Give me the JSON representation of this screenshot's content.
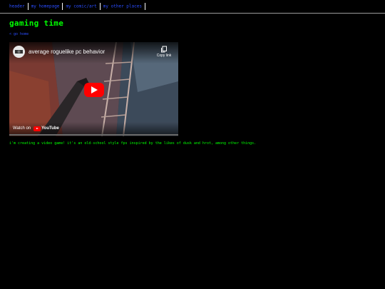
{
  "nav": {
    "links": [
      "header",
      "my homepage",
      "my comic/art",
      "my other places"
    ]
  },
  "page": {
    "title": "gaming time",
    "breadcrumb": "< go home",
    "description": "i'm creating a video game! it's an old-school style fps inspired by the likes of dusk and hrot, among other things."
  },
  "video": {
    "title": "average roguelike pc behavior",
    "copy_label": "Copy link",
    "watch_on": "Watch on",
    "provider": "YouTube"
  },
  "colors": {
    "background": "#000000",
    "text": "#00ff00",
    "link": "#2a4dff",
    "play_button": "#ff0000"
  }
}
